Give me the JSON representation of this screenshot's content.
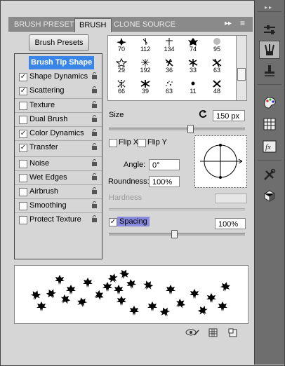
{
  "tabs": [
    {
      "label": "BRUSH PRESETS",
      "active": false
    },
    {
      "label": "BRUSH",
      "active": true
    },
    {
      "label": "CLONE SOURCE",
      "active": false
    }
  ],
  "panel_menu": {
    "collapse_glyph": "▸▸",
    "menu_glyph": "≡"
  },
  "brush_presets_button": "Brush Presets",
  "left_list": [
    {
      "label": "Brush Tip Shape",
      "checked": null,
      "selected": true,
      "lock": false
    },
    {
      "label": "Shape Dynamics",
      "checked": true,
      "selected": false,
      "lock": true
    },
    {
      "label": "Scattering",
      "checked": true,
      "selected": false,
      "lock": true
    },
    {
      "label": "Texture",
      "checked": false,
      "selected": false,
      "lock": true
    },
    {
      "label": "Dual Brush",
      "checked": false,
      "selected": false,
      "lock": true
    },
    {
      "label": "Color Dynamics",
      "checked": true,
      "selected": false,
      "lock": true
    },
    {
      "label": "Transfer",
      "checked": true,
      "selected": false,
      "lock": true
    },
    {
      "label": "Noise",
      "checked": false,
      "selected": false,
      "lock": true
    },
    {
      "label": "Wet Edges",
      "checked": false,
      "selected": false,
      "lock": true
    },
    {
      "label": "Airbrush",
      "checked": false,
      "selected": false,
      "lock": true
    },
    {
      "label": "Smoothing",
      "checked": false,
      "selected": false,
      "lock": true
    },
    {
      "label": "Protect Texture",
      "checked": false,
      "selected": false,
      "lock": true
    }
  ],
  "brush_grid": {
    "rows": [
      [
        "70",
        "112",
        "134",
        "74",
        "95"
      ],
      [
        "29",
        "192",
        "36",
        "33",
        "63"
      ],
      [
        "66",
        "39",
        "63",
        "11",
        "48"
      ]
    ]
  },
  "size": {
    "label": "Size",
    "value": "150 px",
    "slider_fraction": 0.6
  },
  "flip_x": {
    "label": "Flip X",
    "checked": false
  },
  "flip_y": {
    "label": "Flip Y",
    "checked": false
  },
  "angle": {
    "label": "Angle:",
    "value": "0°"
  },
  "roundness": {
    "label": "Roundness:",
    "value": "100%"
  },
  "hardness": {
    "label": "Hardness"
  },
  "spacing": {
    "label": "Spacing",
    "checked": true,
    "value": "100%",
    "slider_fraction": 0.48
  },
  "colors": {
    "selection": "#3a86e8",
    "spacing_highlight": "#8888dd",
    "panel_bg": "#d6d6d6",
    "sidebar_bg": "#6e6e6e"
  }
}
